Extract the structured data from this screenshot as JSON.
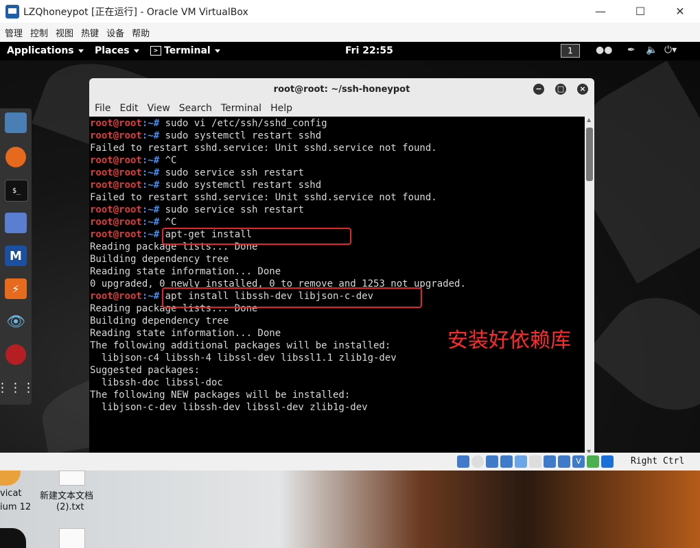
{
  "host_window": {
    "title": "LZQhoneypot [正在运行] - Oracle VM VirtualBox",
    "controls": {
      "minimize": "—",
      "maximize": "☐",
      "close": "✕"
    },
    "menu": [
      "管理",
      "控制",
      "视图",
      "热键",
      "设备",
      "帮助"
    ]
  },
  "guest_topbar": {
    "applications": "Applications",
    "places": "Places",
    "terminal": "Terminal",
    "clock": "Fri 22:55",
    "workspace": "1"
  },
  "dock": {
    "items": [
      "files-icon",
      "firefox-icon",
      "terminal-icon",
      "text-editor-icon",
      "metasploit-icon",
      "burpsuite-icon",
      "eye-icon",
      "cherrytree-icon",
      "app-grid-icon"
    ]
  },
  "terminal": {
    "title": "root@root: ~/ssh-honeypot",
    "menu": [
      "File",
      "Edit",
      "View",
      "Search",
      "Terminal",
      "Help"
    ],
    "prompt_user": "root@root",
    "prompt_path": ":~#",
    "lines": [
      {
        "type": "cmd",
        "text": " sudo vi /etc/ssh/sshd_config"
      },
      {
        "type": "cmd",
        "text": " sudo systemctl restart sshd"
      },
      {
        "type": "out",
        "text": "Failed to restart sshd.service: Unit sshd.service not found."
      },
      {
        "type": "cmd",
        "text": " ^C"
      },
      {
        "type": "cmd",
        "text": " sudo service ssh restart"
      },
      {
        "type": "cmd",
        "text": " sudo systemctl restart sshd"
      },
      {
        "type": "out",
        "text": "Failed to restart sshd.service: Unit sshd.service not found."
      },
      {
        "type": "cmd",
        "text": " sudo service ssh restart"
      },
      {
        "type": "cmd",
        "text": " ^C"
      },
      {
        "type": "cmd",
        "text": " apt-get install"
      },
      {
        "type": "out",
        "text": "Reading package lists... Done"
      },
      {
        "type": "out",
        "text": "Building dependency tree"
      },
      {
        "type": "out",
        "text": "Reading state information... Done"
      },
      {
        "type": "out",
        "text": "0 upgraded, 0 newly installed, 0 to remove and 1253 not upgraded."
      },
      {
        "type": "cmd",
        "text": " apt install libssh-dev libjson-c-dev"
      },
      {
        "type": "out",
        "text": "Reading package lists... Done"
      },
      {
        "type": "out",
        "text": "Building dependency tree"
      },
      {
        "type": "out",
        "text": "Reading state information... Done"
      },
      {
        "type": "out",
        "text": "The following additional packages will be installed:"
      },
      {
        "type": "out",
        "text": "  libjson-c4 libssh-4 libssl-dev libssl1.1 zlib1g-dev"
      },
      {
        "type": "out",
        "text": "Suggested packages:"
      },
      {
        "type": "out",
        "text": "  libssh-doc libssl-doc"
      },
      {
        "type": "out",
        "text": "The following NEW packages will be installed:"
      },
      {
        "type": "out",
        "text": "  libjson-c-dev libssh-dev libssl-dev zlib1g-dev"
      }
    ],
    "annotation": "安装好依赖库"
  },
  "status_bar": {
    "host_key": "Right Ctrl"
  },
  "host_desktop": {
    "icons": [
      {
        "label1": "vicat",
        "label2": "ium 12"
      },
      {
        "label1": "新建文本文档",
        "label2": "(2).txt"
      }
    ]
  },
  "colors": {
    "prompt_user": "#e03b3b",
    "prompt_path": "#4a8fe7",
    "highlight": "#e22626",
    "annotation": "#ff2b2b"
  }
}
